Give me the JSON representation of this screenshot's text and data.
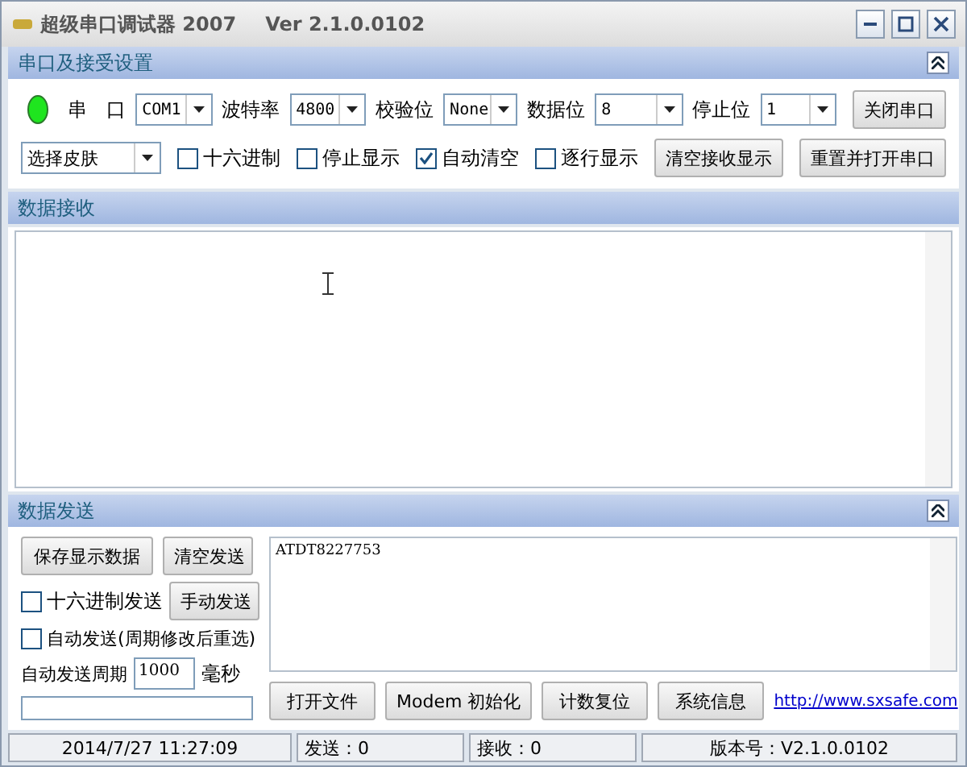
{
  "window": {
    "title": "超级串口调试器 2007",
    "version": "Ver 2.1.0.0102"
  },
  "settings": {
    "title": "串口及接受设置",
    "port_open": true,
    "fields": [
      {
        "label": "串　口",
        "value": "COM1"
      },
      {
        "label": "波特率",
        "value": "4800"
      },
      {
        "label": "校验位",
        "value": "None"
      },
      {
        "label": "数据位",
        "value": "8"
      },
      {
        "label": "停止位",
        "value": "1"
      }
    ],
    "close_button": "关闭串口",
    "skin_select": "选择皮肤",
    "checkboxes": [
      {
        "label": "十六进制",
        "checked": false
      },
      {
        "label": "停止显示",
        "checked": false
      },
      {
        "label": "自动清空",
        "checked": true
      },
      {
        "label": "逐行显示",
        "checked": false
      }
    ],
    "buttons": [
      "清空接收显示",
      "重置并打开串口"
    ]
  },
  "receive": {
    "title": "数据接收"
  },
  "send": {
    "title": "数据发送",
    "save_button": "保存显示数据",
    "clear_button": "清空发送",
    "hex_checkbox": {
      "label": "十六进制发送",
      "checked": false
    },
    "manual_button": "手动发送",
    "auto_checkbox": {
      "label": "自动发送(周期修改后重选)",
      "checked": false
    },
    "period_label": "自动发送周期",
    "period_value": "1000",
    "period_unit": "毫秒",
    "text": "ATDT8227753",
    "buttons": [
      "打开文件",
      "Modem 初始化",
      "计数复位",
      "系统信息"
    ],
    "link": "http://www.sxsafe.com"
  },
  "status_bar": [
    "2014/7/27 11:27:09",
    "发送：0",
    "接收：0",
    "版本号：V2.1.0.0102"
  ]
}
